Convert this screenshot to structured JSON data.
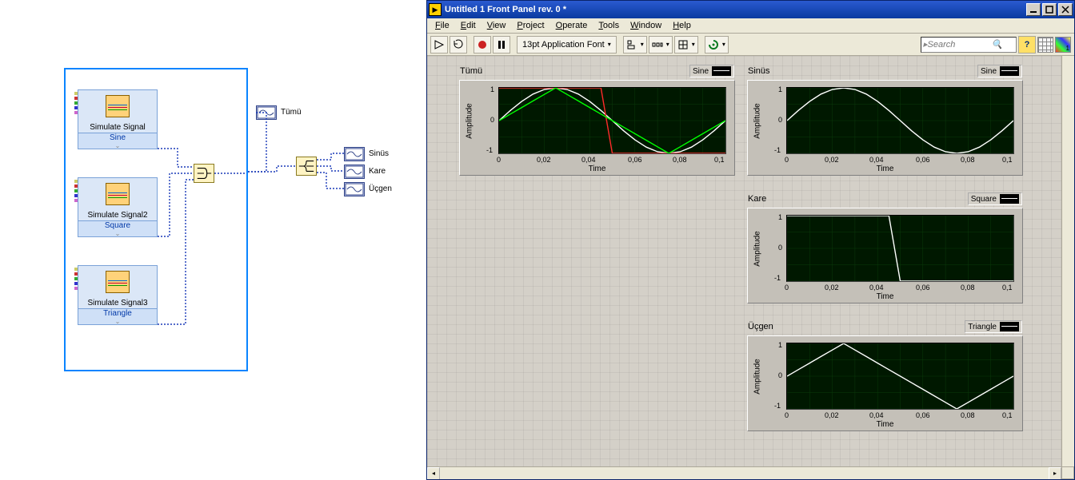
{
  "window": {
    "title": "Untitled 1 Front Panel rev. 0 *"
  },
  "menu": {
    "file": "File",
    "edit": "Edit",
    "view": "View",
    "project": "Project",
    "operate": "Operate",
    "tools": "Tools",
    "window": "Window",
    "help": "Help"
  },
  "toolbar": {
    "font": "13pt Application Font",
    "search_placeholder": "Search"
  },
  "diagram": {
    "sim1_label": "Simulate Signal",
    "sim1_type": "Sine",
    "sim2_label": "Simulate Signal2",
    "sim2_type": "Square",
    "sim3_label": "Simulate Signal3",
    "sim3_type": "Triangle",
    "out_all": "Tümü",
    "out_sinus": "Sinüs",
    "out_kare": "Kare",
    "out_ucgen": "Üçgen"
  },
  "graphs": {
    "tumu": {
      "title": "Tümü",
      "legend": "Sine",
      "ylabel": "Amplitude",
      "xlabel": "Time"
    },
    "sinus": {
      "title": "Sinüs",
      "legend": "Sine",
      "ylabel": "Amplitude",
      "xlabel": "Time"
    },
    "kare": {
      "title": "Kare",
      "legend": "Square",
      "ylabel": "Amplitude",
      "xlabel": "Time"
    },
    "ucgen": {
      "title": "Üçgen",
      "legend": "Triangle",
      "ylabel": "Amplitude",
      "xlabel": "Time"
    },
    "xticks": [
      "0",
      "0,02",
      "0,04",
      "0,06",
      "0,08",
      "0,1"
    ],
    "yticks": [
      "1",
      "0",
      "-1"
    ]
  },
  "chart_data": [
    {
      "id": "tumu",
      "type": "line",
      "title": "Tümü",
      "xlabel": "Time",
      "ylabel": "Amplitude",
      "xlim": [
        0,
        0.1
      ],
      "ylim": [
        -1,
        1
      ],
      "x": [
        0,
        0.005,
        0.01,
        0.015,
        0.02,
        0.025,
        0.03,
        0.035,
        0.04,
        0.045,
        0.05,
        0.055,
        0.06,
        0.065,
        0.07,
        0.075,
        0.08,
        0.085,
        0.09,
        0.095,
        0.1
      ],
      "series": [
        {
          "name": "Sine",
          "color": "#ffffff",
          "values": [
            0,
            0.309,
            0.588,
            0.809,
            0.951,
            1,
            0.951,
            0.809,
            0.588,
            0.309,
            0,
            -0.309,
            -0.588,
            -0.809,
            -0.951,
            -1,
            -0.951,
            -0.809,
            -0.588,
            -0.309,
            0
          ]
        },
        {
          "name": "Square",
          "color": "#ff2a2a",
          "values": [
            1,
            1,
            1,
            1,
            1,
            1,
            1,
            1,
            1,
            1,
            -1,
            -1,
            -1,
            -1,
            -1,
            -1,
            -1,
            -1,
            -1,
            -1,
            -1
          ]
        },
        {
          "name": "Triangle",
          "color": "#00ff00",
          "values": [
            0,
            0.2,
            0.4,
            0.6,
            0.8,
            1,
            0.8,
            0.6,
            0.4,
            0.2,
            0,
            -0.2,
            -0.4,
            -0.6,
            -0.8,
            -1,
            -0.8,
            -0.6,
            -0.4,
            -0.2,
            0
          ]
        }
      ]
    },
    {
      "id": "sinus",
      "type": "line",
      "title": "Sinüs",
      "xlabel": "Time",
      "ylabel": "Amplitude",
      "xlim": [
        0,
        0.1
      ],
      "ylim": [
        -1,
        1
      ],
      "x": [
        0,
        0.005,
        0.01,
        0.015,
        0.02,
        0.025,
        0.03,
        0.035,
        0.04,
        0.045,
        0.05,
        0.055,
        0.06,
        0.065,
        0.07,
        0.075,
        0.08,
        0.085,
        0.09,
        0.095,
        0.1
      ],
      "series": [
        {
          "name": "Sine",
          "color": "#ffffff",
          "values": [
            0,
            0.309,
            0.588,
            0.809,
            0.951,
            1,
            0.951,
            0.809,
            0.588,
            0.309,
            0,
            -0.309,
            -0.588,
            -0.809,
            -0.951,
            -1,
            -0.951,
            -0.809,
            -0.588,
            -0.309,
            0
          ]
        }
      ]
    },
    {
      "id": "kare",
      "type": "line",
      "title": "Kare",
      "xlabel": "Time",
      "ylabel": "Amplitude",
      "xlim": [
        0,
        0.1
      ],
      "ylim": [
        -1,
        1
      ],
      "x": [
        0,
        0.005,
        0.01,
        0.015,
        0.02,
        0.025,
        0.03,
        0.035,
        0.04,
        0.045,
        0.05,
        0.055,
        0.06,
        0.065,
        0.07,
        0.075,
        0.08,
        0.085,
        0.09,
        0.095,
        0.1
      ],
      "series": [
        {
          "name": "Square",
          "color": "#ffffff",
          "values": [
            1,
            1,
            1,
            1,
            1,
            1,
            1,
            1,
            1,
            1,
            -1,
            -1,
            -1,
            -1,
            -1,
            -1,
            -1,
            -1,
            -1,
            -1,
            -1
          ]
        }
      ]
    },
    {
      "id": "ucgen",
      "type": "line",
      "title": "Üçgen",
      "xlabel": "Time",
      "ylabel": "Amplitude",
      "xlim": [
        0,
        0.1
      ],
      "ylim": [
        -1,
        1
      ],
      "x": [
        0,
        0.005,
        0.01,
        0.015,
        0.02,
        0.025,
        0.03,
        0.035,
        0.04,
        0.045,
        0.05,
        0.055,
        0.06,
        0.065,
        0.07,
        0.075,
        0.08,
        0.085,
        0.09,
        0.095,
        0.1
      ],
      "series": [
        {
          "name": "Triangle",
          "color": "#ffffff",
          "values": [
            0,
            0.2,
            0.4,
            0.6,
            0.8,
            1,
            0.8,
            0.6,
            0.4,
            0.2,
            0,
            -0.2,
            -0.4,
            -0.6,
            -0.8,
            -1,
            -0.8,
            -0.6,
            -0.4,
            -0.2,
            0
          ]
        }
      ]
    }
  ]
}
